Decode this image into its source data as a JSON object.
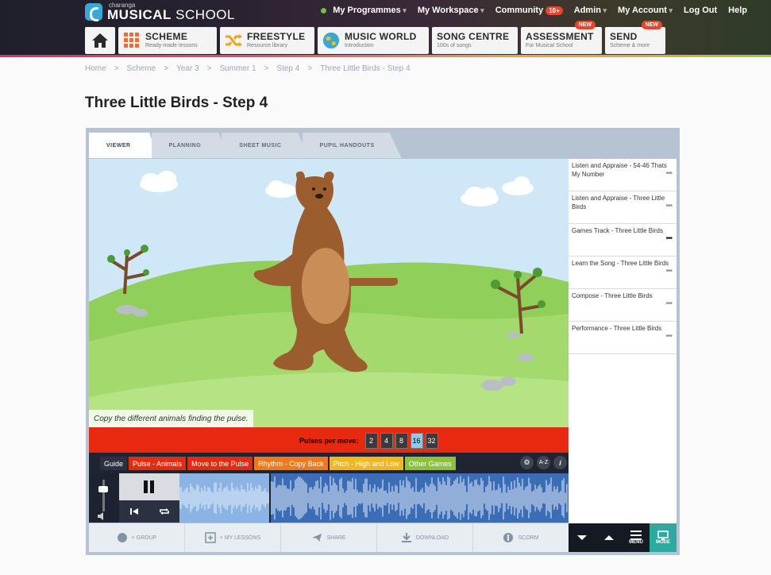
{
  "logo": {
    "small": "charanga",
    "brand_bold": "MUSICAL",
    "brand_rest": " SCHOOL"
  },
  "topnav": [
    {
      "label": "My Programmes"
    },
    {
      "label": "My Workspace"
    },
    {
      "label": "Community",
      "badge": "10+"
    },
    {
      "label": "Admin"
    },
    {
      "label": "My Account"
    },
    {
      "label": "Log Out"
    },
    {
      "label": "Help"
    }
  ],
  "tiles": [
    {
      "icon": "home-icon"
    },
    {
      "title": "SCHEME",
      "sub": "Ready-made lessons",
      "icon": "grid-icon",
      "color": "#f06a3a"
    },
    {
      "title": "FREESTYLE",
      "sub": "Resource library",
      "icon": "shuffle-icon",
      "color": "#f2a11b"
    },
    {
      "title": "MUSIC WORLD",
      "sub": "Introduction",
      "icon": "globe-icon",
      "color": "#3aa7d9"
    },
    {
      "title": "SONG CENTRE",
      "sub": "100s of songs",
      "icon": "none"
    },
    {
      "title": "ASSESSMENT",
      "sub": "For Musical School",
      "badge": "NEW"
    },
    {
      "title": "SEND",
      "sub": "Scheme & more",
      "badge": "NEW"
    }
  ],
  "breadcrumb": [
    "Home",
    ">",
    "Scheme",
    ">",
    "Year 3",
    ">",
    "Summer 1",
    ">",
    "Step 4",
    ">",
    "Three Little Birds - Step 4"
  ],
  "page_title": "Three Little Birds - Step 4",
  "tabs": [
    "VIEWER",
    "PLANNING",
    "SHEET MUSIC",
    "PUPIL HANDOUTS"
  ],
  "caption": "Copy the different animals finding the pulse.",
  "sidelist": [
    {
      "label": "Listen and Appraise - 54-46 Thats My Number",
      "more": "•••"
    },
    {
      "label": "Listen and Appraise - Three Little Birds",
      "more": "•••"
    },
    {
      "label": "Games Track - Three Little Birds",
      "more": "•••",
      "active": true
    },
    {
      "label": "Learn the Song - Three Little Birds",
      "more": "•••"
    },
    {
      "label": "Compose - Three Little Birds",
      "more": "•••"
    },
    {
      "label": "Performance - Three Little Birds",
      "more": "•••"
    }
  ],
  "pulses": {
    "label": "Pulses per move:",
    "options": [
      "2",
      "4",
      "8",
      "16",
      "32"
    ],
    "selected": "16"
  },
  "gametabs": [
    {
      "label": "Guide",
      "color": "#2b3140"
    },
    {
      "label": "Pulse - Animals",
      "color": "#e8280f"
    },
    {
      "label": "Move to the Pulse",
      "color": "#e8280f"
    },
    {
      "label": "Rhythm - Copy Back",
      "color": "#f07a1a"
    },
    {
      "label": "Pitch - High and Low",
      "color": "#f2b81b"
    },
    {
      "label": "Other Games",
      "color": "#8bc23a"
    }
  ],
  "gamectrls": {
    "settings": "⚙",
    "az": "A-Z",
    "info": "i"
  },
  "bottombar": [
    {
      "label": "+ GROUP",
      "icon": "globe-icon"
    },
    {
      "label": "+ MY LESSONS",
      "icon": "plus-square-icon"
    },
    {
      "label": "SHARE",
      "icon": "share-icon"
    },
    {
      "label": "DOWNLOAD",
      "icon": "download-icon"
    },
    {
      "label": "SCORM",
      "icon": "scorm-icon"
    }
  ],
  "navbtns": {
    "menu": "MENU",
    "mode": "MODE"
  }
}
